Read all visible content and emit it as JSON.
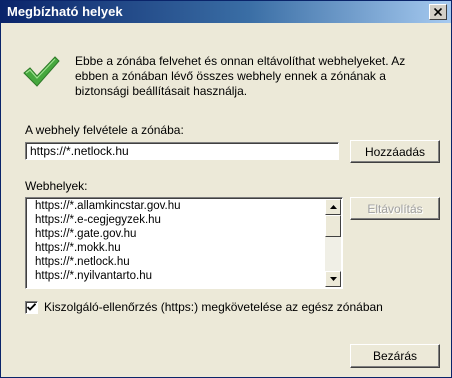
{
  "window": {
    "title": "Megbízható helyek"
  },
  "info": {
    "text": "Ebbe a zónába felvehet és onnan eltávolíthat webhelyeket. Az ebben a zónában lévő összes webhely ennek a zónának a biztonsági beállításait használja.",
    "icon": "checkmark-icon",
    "icon_color": "#3aa63a"
  },
  "add_site": {
    "label": "A webhely felvétele a zónába:",
    "value": "https://*.netlock.hu",
    "button_label": "Hozzáadás"
  },
  "websites": {
    "label": "Webhelyek:",
    "items": [
      "https://*.allamkincstar.gov.hu",
      "https://*.e-cegjegyzek.hu",
      "https://*.gate.gov.hu",
      "https://*.mokk.hu",
      "https://*.netlock.hu",
      "https://*.nyilvantarto.hu"
    ],
    "remove_label": "Eltávolítás"
  },
  "https_check": {
    "label": "Kiszolgáló-ellenőrzés (https:) megkövetelése az egész zónában",
    "checked": true
  },
  "close_button": {
    "label": "Bezárás"
  }
}
